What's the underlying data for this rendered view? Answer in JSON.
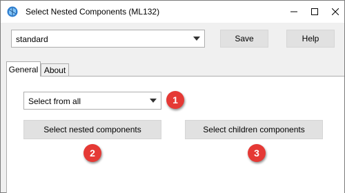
{
  "window": {
    "title": "Select Nested Components (ML132)",
    "app_icon": "app-logo-icon",
    "controls": [
      "minimize-icon",
      "maximize-icon",
      "close-icon"
    ]
  },
  "toolbar": {
    "profile_value": "standard",
    "save_label": "Save",
    "help_label": "Help"
  },
  "tabs": [
    {
      "label": "General",
      "active": true
    },
    {
      "label": "About",
      "active": false
    }
  ],
  "general": {
    "select_scope_value": "Select from all",
    "nested_button_label": "Select nested components",
    "children_button_label": "Select children components"
  },
  "callouts": [
    {
      "number": "1"
    },
    {
      "number": "2"
    },
    {
      "number": "3"
    }
  ],
  "colors": {
    "callout_red": "#e53935",
    "window_bg": "#f0f0f0",
    "button_bg": "#e1e1e1"
  }
}
